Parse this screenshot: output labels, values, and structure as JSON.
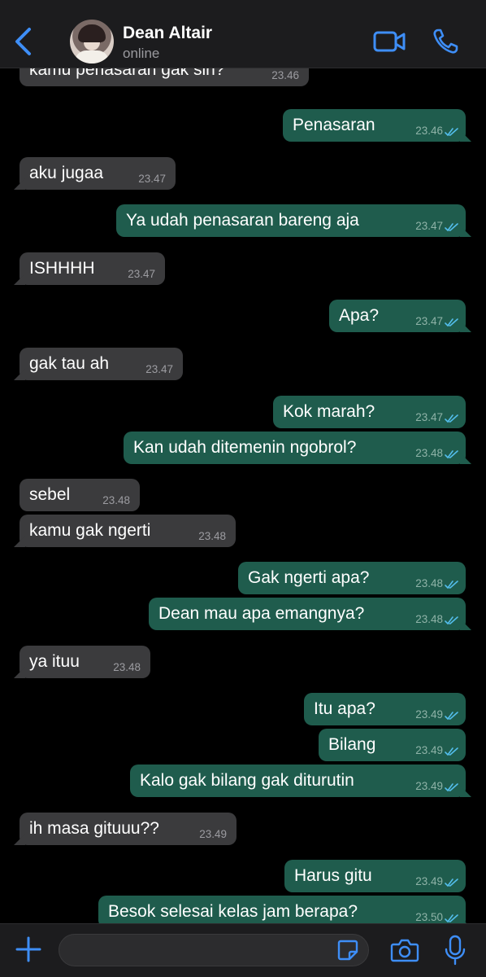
{
  "header": {
    "contact_name": "Dean Altair",
    "status": "online",
    "icons": [
      "chevron-left-icon",
      "video-call-icon",
      "phone-icon"
    ],
    "accent_color": "#3e8ef7"
  },
  "colors": {
    "incoming_bubble": "#3b3b3d",
    "outgoing_bubble": "#1f5c4d",
    "read_ticks": "#53bdeb"
  },
  "messages": [
    {
      "dir": "in",
      "text": "kamu penasaran gak sih?",
      "time": "23.46"
    },
    {
      "dir": "out",
      "text": "Penasaran",
      "time": "23.46"
    },
    {
      "dir": "in",
      "text": "aku jugaa",
      "time": "23.47"
    },
    {
      "dir": "out",
      "text": "Ya udah penasaran bareng aja",
      "time": "23.47"
    },
    {
      "dir": "in",
      "text": "ISHHHH",
      "time": "23.47"
    },
    {
      "dir": "out",
      "text": "Apa?",
      "time": "23.47"
    },
    {
      "dir": "in",
      "text": "gak tau ah",
      "time": "23.47"
    },
    {
      "dir": "out",
      "text": "Kok marah?",
      "time": "23.47"
    },
    {
      "dir": "out",
      "text": "Kan udah ditemenin ngobrol?",
      "time": "23.48"
    },
    {
      "dir": "in",
      "text": "sebel",
      "time": "23.48"
    },
    {
      "dir": "in",
      "text": "kamu gak ngerti",
      "time": "23.48"
    },
    {
      "dir": "out",
      "text": "Gak ngerti apa?",
      "time": "23.48"
    },
    {
      "dir": "out",
      "text": "Dean mau apa emangnya?",
      "time": "23.48"
    },
    {
      "dir": "in",
      "text": "ya ituu",
      "time": "23.48"
    },
    {
      "dir": "out",
      "text": "Itu apa?",
      "time": "23.49"
    },
    {
      "dir": "out",
      "text": "Bilang",
      "time": "23.49"
    },
    {
      "dir": "out",
      "text": "Kalo gak bilang gak diturutin",
      "time": "23.49"
    },
    {
      "dir": "in",
      "text": "ih masa gituuu??",
      "time": "23.49"
    },
    {
      "dir": "out",
      "text": "Harus gitu",
      "time": "23.49"
    },
    {
      "dir": "out",
      "text": "Besok selesai kelas jam berapa?",
      "time": "23.50"
    }
  ],
  "composer": {
    "input_value": "",
    "icons": [
      "plus-icon",
      "sticker-icon",
      "camera-icon",
      "microphone-icon"
    ]
  }
}
